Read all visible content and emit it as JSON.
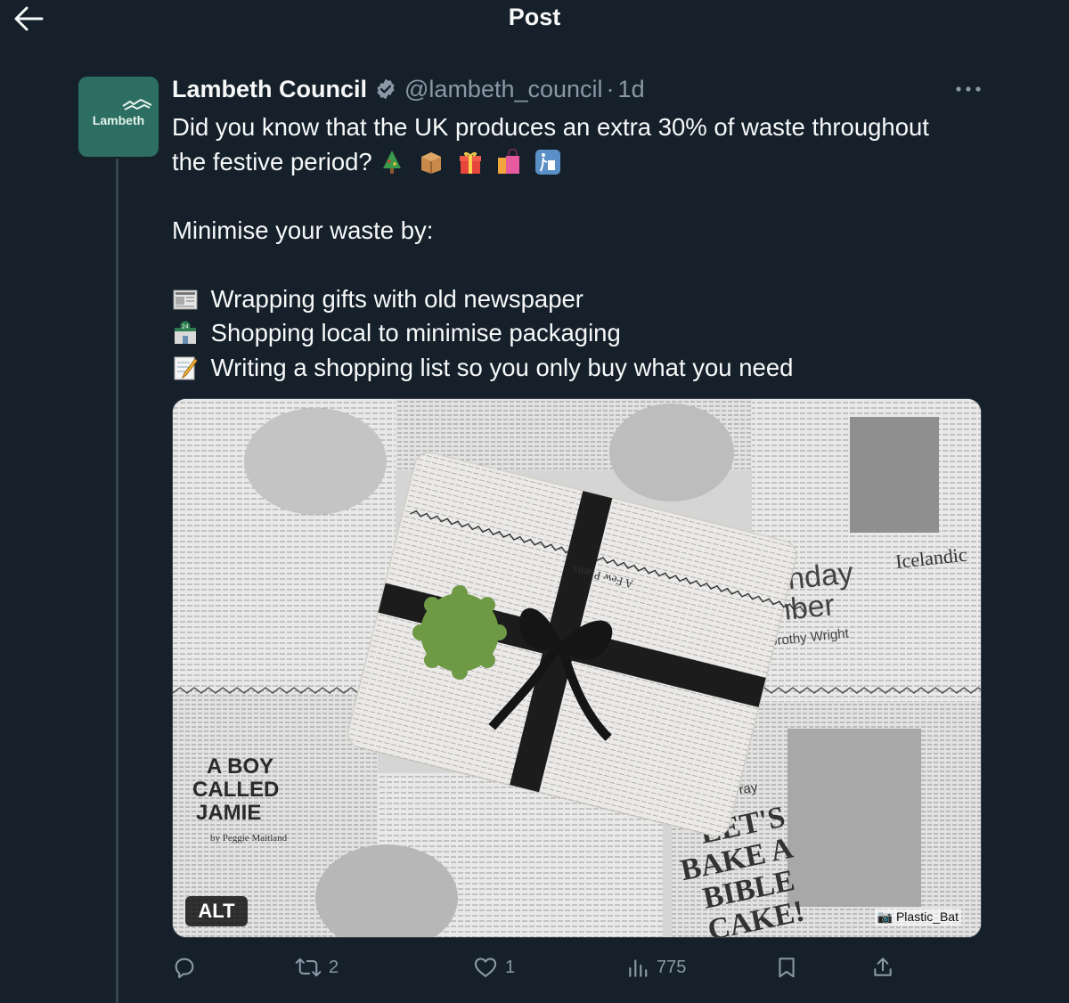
{
  "page": {
    "title": "Post"
  },
  "post": {
    "author": {
      "display_name": "Lambeth Council",
      "handle": "@lambeth_council",
      "avatar_text": "Lambeth",
      "verified": true
    },
    "timestamp": "1d",
    "separator": "·",
    "text": {
      "line1": "Did you know that the UK produces an extra 30% of waste throughout",
      "line2": "the festive period?",
      "line2_emojis": [
        "christmas-tree-icon",
        "package-icon",
        "gift-icon",
        "shopping-bags-icon",
        "litter-bin-icon"
      ],
      "intro": "Minimise your waste by:",
      "tips": [
        {
          "icon": "newspaper-icon",
          "text": "Wrapping gifts with old newspaper"
        },
        {
          "icon": "convenience-store-icon",
          "text": "Shopping local to minimise packaging"
        },
        {
          "icon": "memo-icon",
          "text": "Writing a shopping list so you only buy what you need"
        }
      ]
    },
    "media": {
      "alt_label": "ALT",
      "credit": "Plastic_Bat",
      "newspaper_texts": {
        "headline_left": "A BOY CALLED JAMIE",
        "byline_left": "by Peggie Maitland",
        "headline_right_1": "Sunday",
        "headline_right_2": "ember",
        "byline_right": "by Dorothy Wright",
        "corner_mast": "Icelandic",
        "cake_title": "LET'S BAKE A BIBLE CAKE!",
        "cake_byline": "ne Murray",
        "plain_tag": "A Few Plants"
      }
    },
    "metrics": {
      "replies": "",
      "reposts": "2",
      "likes": "1",
      "views": "775"
    }
  },
  "colors": {
    "background": "#15202b",
    "text": "#f7f9f9",
    "muted": "#8b98a5",
    "verified": "#8b98a5",
    "avatar": "#2c6f62"
  }
}
